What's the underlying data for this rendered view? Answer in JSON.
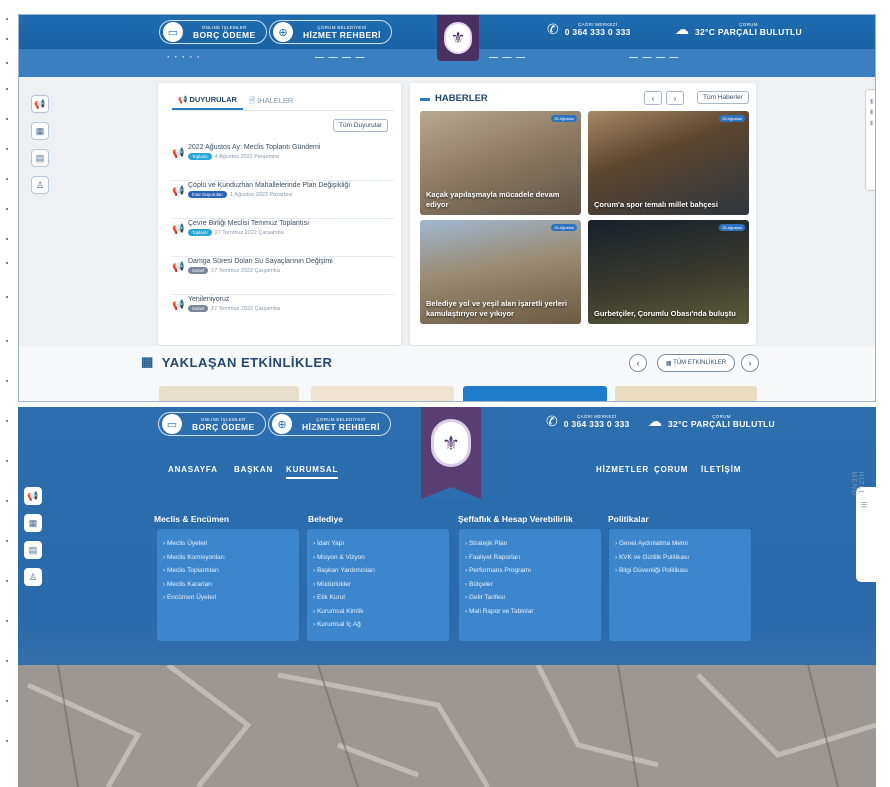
{
  "top": {
    "borc": {
      "small": "ONLINE İŞLEMLER",
      "big": "BORÇ ÖDEME"
    },
    "hizmet": {
      "small": "ÇORUM BELEDİYESİ",
      "big": "HİZMET REHBERİ"
    },
    "phone": {
      "small": "ÇAĞRI MERKEZİ",
      "big": "0 364 333 0 333"
    },
    "weather": {
      "small": "ÇORUM",
      "big": "32°C PARÇALI BULUTLU"
    },
    "duyurular_tab": "DUYURULAR",
    "ihaleler_tab": "İHALELER",
    "tum_duyurular": "Tüm Duyurular",
    "announcements": [
      {
        "title": "2022 Ağustos Ay: Meclis Toplantı Gündemi",
        "badge": "Toplantı",
        "date": "4 Ağustos 2022 Perşembe"
      },
      {
        "title": "Çöplü ve Kunduzhan Mahallelerinde Plan Değişikliği",
        "badge": "İmar Duyuruları",
        "date": "1 Ağustos 2022 Pazartesi"
      },
      {
        "title": "Çevre Birliği Meclisi Temmuz Toplantısı",
        "badge": "Toplantı",
        "date": "27 Temmuz 2022 Çarşamba"
      },
      {
        "title": "Damga Süresi Dolan Su Sayaçlarının Değişimi",
        "badge": "Genel",
        "date": "27 Temmuz 2022 Çarşamba"
      },
      {
        "title": "Yenileniyoruz",
        "badge": "Genel",
        "date": "27 Temmuz 2022 Çarşamba"
      }
    ],
    "haberler_title": "HABERLER",
    "tum_haberler": "Tüm Haberler",
    "news": [
      {
        "date": "25 Ağustos",
        "caption": "Kaçak yapılaşmayla mücadele devam ediyor"
      },
      {
        "date": "25 Ağustos",
        "caption": "Çorum'a spor temalı millet bahçesi"
      },
      {
        "date": "25 Ağustos",
        "caption": "Belediye yol ve yeşil alan işaretli yerleri kamulaştırıyor ve yıkıyor"
      },
      {
        "date": "25 Ağustos",
        "caption": "Gurbetçiler, Çorumlu Obası'nda buluştu"
      }
    ],
    "etkinlik_title": "YAKLAŞAN ETKİNLİKLER",
    "tum_etkinlikler": "TÜM ETKİNLİKLER"
  },
  "bottom": {
    "borc": {
      "small": "ONLINE İŞLEMLER",
      "big": "BORÇ ÖDEME"
    },
    "hizmet": {
      "small": "ÇORUM BELEDİYESİ",
      "big": "HİZMET REHBERİ"
    },
    "phone": {
      "small": "ÇAĞRI MERKEZİ",
      "big": "0 364 333 0 333"
    },
    "weather": {
      "small": "ÇORUM",
      "big": "32°C PARÇALI BULUTLU"
    },
    "nav_left": [
      "ANASAYFA",
      "BAŞKAN",
      "KURUMSAL"
    ],
    "nav_right": [
      "HİZMETLER",
      "ÇORUM",
      "İLETİŞİM"
    ],
    "hizli_menu": "HIZLI MENÜ",
    "columns": [
      {
        "title": "Meclis & Encümen",
        "items": [
          "› Meclis Üyeleri",
          "› Meclis Komisyonları",
          "› Meclis Toplantıları",
          "› Meclis Kararları",
          "› Encümen Üyeleri"
        ]
      },
      {
        "title": "Belediye",
        "items": [
          "› İdari Yapı",
          "› Misyon & Vizyon",
          "› Başkan Yardımcıları",
          "› Müdürlükler",
          "› Etik Kurul",
          "› Kurumsal Kimlik",
          "› Kurumsal İç Ağ"
        ]
      },
      {
        "title": "Şeffaflık & Hesap Verebilirlik",
        "items": [
          "› Stratejik Plan",
          "› Faaliyet Raporları",
          "› Performans Programı",
          "› Bütçeler",
          "› Gelir Tarifesi",
          "› Mali Rapor ve Tablolar"
        ]
      },
      {
        "title": "Politikalar",
        "items": [
          "› Genel Aydınlatma Metni",
          "› KVK ve Gizlilik Politikası",
          "› Bilgi Güvenliği Politikası"
        ]
      }
    ]
  }
}
